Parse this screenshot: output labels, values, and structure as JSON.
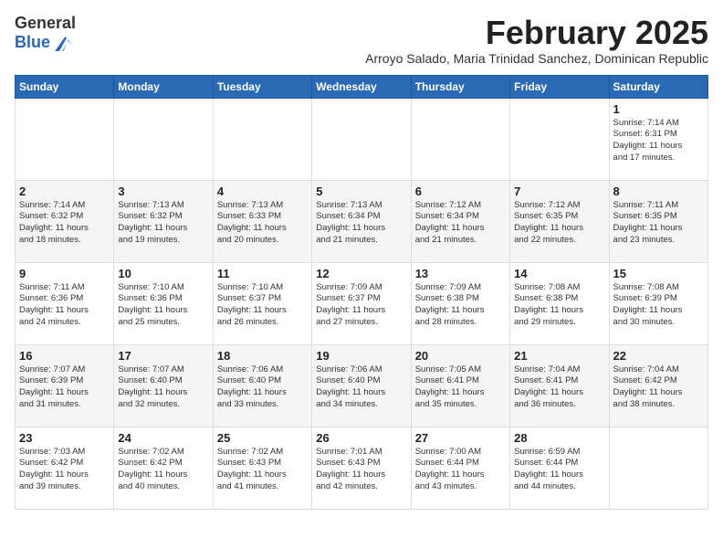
{
  "logo": {
    "general": "General",
    "blue": "Blue"
  },
  "title": "February 2025",
  "subtitle": "Arroyo Salado, Maria Trinidad Sanchez, Dominican Republic",
  "weekdays": [
    "Sunday",
    "Monday",
    "Tuesday",
    "Wednesday",
    "Thursday",
    "Friday",
    "Saturday"
  ],
  "weeks": [
    [
      {
        "day": "",
        "info": ""
      },
      {
        "day": "",
        "info": ""
      },
      {
        "day": "",
        "info": ""
      },
      {
        "day": "",
        "info": ""
      },
      {
        "day": "",
        "info": ""
      },
      {
        "day": "",
        "info": ""
      },
      {
        "day": "1",
        "info": "Sunrise: 7:14 AM\nSunset: 6:31 PM\nDaylight: 11 hours\nand 17 minutes."
      }
    ],
    [
      {
        "day": "2",
        "info": "Sunrise: 7:14 AM\nSunset: 6:32 PM\nDaylight: 11 hours\nand 18 minutes."
      },
      {
        "day": "3",
        "info": "Sunrise: 7:13 AM\nSunset: 6:32 PM\nDaylight: 11 hours\nand 19 minutes."
      },
      {
        "day": "4",
        "info": "Sunrise: 7:13 AM\nSunset: 6:33 PM\nDaylight: 11 hours\nand 20 minutes."
      },
      {
        "day": "5",
        "info": "Sunrise: 7:13 AM\nSunset: 6:34 PM\nDaylight: 11 hours\nand 21 minutes."
      },
      {
        "day": "6",
        "info": "Sunrise: 7:12 AM\nSunset: 6:34 PM\nDaylight: 11 hours\nand 21 minutes."
      },
      {
        "day": "7",
        "info": "Sunrise: 7:12 AM\nSunset: 6:35 PM\nDaylight: 11 hours\nand 22 minutes."
      },
      {
        "day": "8",
        "info": "Sunrise: 7:11 AM\nSunset: 6:35 PM\nDaylight: 11 hours\nand 23 minutes."
      }
    ],
    [
      {
        "day": "9",
        "info": "Sunrise: 7:11 AM\nSunset: 6:36 PM\nDaylight: 11 hours\nand 24 minutes."
      },
      {
        "day": "10",
        "info": "Sunrise: 7:10 AM\nSunset: 6:36 PM\nDaylight: 11 hours\nand 25 minutes."
      },
      {
        "day": "11",
        "info": "Sunrise: 7:10 AM\nSunset: 6:37 PM\nDaylight: 11 hours\nand 26 minutes."
      },
      {
        "day": "12",
        "info": "Sunrise: 7:09 AM\nSunset: 6:37 PM\nDaylight: 11 hours\nand 27 minutes."
      },
      {
        "day": "13",
        "info": "Sunrise: 7:09 AM\nSunset: 6:38 PM\nDaylight: 11 hours\nand 28 minutes."
      },
      {
        "day": "14",
        "info": "Sunrise: 7:08 AM\nSunset: 6:38 PM\nDaylight: 11 hours\nand 29 minutes."
      },
      {
        "day": "15",
        "info": "Sunrise: 7:08 AM\nSunset: 6:39 PM\nDaylight: 11 hours\nand 30 minutes."
      }
    ],
    [
      {
        "day": "16",
        "info": "Sunrise: 7:07 AM\nSunset: 6:39 PM\nDaylight: 11 hours\nand 31 minutes."
      },
      {
        "day": "17",
        "info": "Sunrise: 7:07 AM\nSunset: 6:40 PM\nDaylight: 11 hours\nand 32 minutes."
      },
      {
        "day": "18",
        "info": "Sunrise: 7:06 AM\nSunset: 6:40 PM\nDaylight: 11 hours\nand 33 minutes."
      },
      {
        "day": "19",
        "info": "Sunrise: 7:06 AM\nSunset: 6:40 PM\nDaylight: 11 hours\nand 34 minutes."
      },
      {
        "day": "20",
        "info": "Sunrise: 7:05 AM\nSunset: 6:41 PM\nDaylight: 11 hours\nand 35 minutes."
      },
      {
        "day": "21",
        "info": "Sunrise: 7:04 AM\nSunset: 6:41 PM\nDaylight: 11 hours\nand 36 minutes."
      },
      {
        "day": "22",
        "info": "Sunrise: 7:04 AM\nSunset: 6:42 PM\nDaylight: 11 hours\nand 38 minutes."
      }
    ],
    [
      {
        "day": "23",
        "info": "Sunrise: 7:03 AM\nSunset: 6:42 PM\nDaylight: 11 hours\nand 39 minutes."
      },
      {
        "day": "24",
        "info": "Sunrise: 7:02 AM\nSunset: 6:42 PM\nDaylight: 11 hours\nand 40 minutes."
      },
      {
        "day": "25",
        "info": "Sunrise: 7:02 AM\nSunset: 6:43 PM\nDaylight: 11 hours\nand 41 minutes."
      },
      {
        "day": "26",
        "info": "Sunrise: 7:01 AM\nSunset: 6:43 PM\nDaylight: 11 hours\nand 42 minutes."
      },
      {
        "day": "27",
        "info": "Sunrise: 7:00 AM\nSunset: 6:44 PM\nDaylight: 11 hours\nand 43 minutes."
      },
      {
        "day": "28",
        "info": "Sunrise: 6:59 AM\nSunset: 6:44 PM\nDaylight: 11 hours\nand 44 minutes."
      },
      {
        "day": "",
        "info": ""
      }
    ]
  ]
}
